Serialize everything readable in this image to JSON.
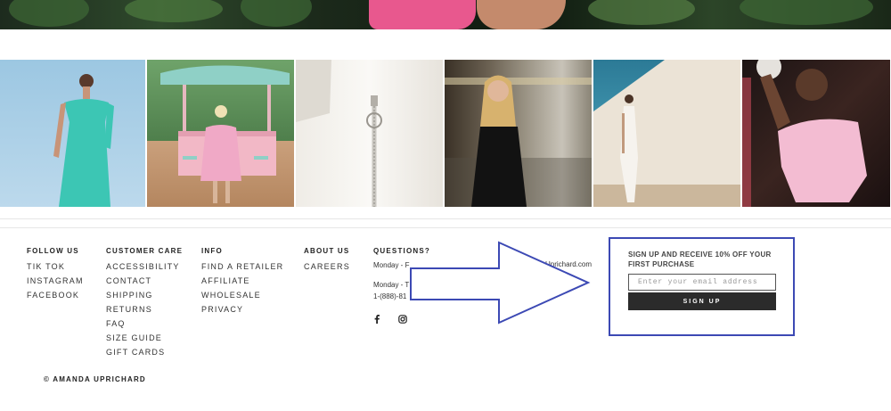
{
  "footer": {
    "follow_us": {
      "heading": "FOLLOW US",
      "items": [
        "TIK TOK",
        "INSTAGRAM",
        "FACEBOOK"
      ]
    },
    "customer_care": {
      "heading": "CUSTOMER CARE",
      "items": [
        "ACCESSIBILITY",
        "CONTACT",
        "SHIPPING",
        "RETURNS",
        "FAQ",
        "SIZE GUIDE",
        "GIFT CARDS"
      ]
    },
    "info": {
      "heading": "INFO",
      "items": [
        "FIND A RETAILER",
        "AFFILIATE",
        "WHOLESALE",
        "PRIVACY"
      ]
    },
    "about_us": {
      "heading": "ABOUT US",
      "items": [
        "CAREERS"
      ]
    },
    "questions": {
      "heading": "QUESTIONS?",
      "line1_start": "Monday - F",
      "line1_end": "Uprichard.com",
      "line2_start": "Monday - T",
      "phone_start": "1-(888)-81"
    },
    "social_icons": [
      "facebook-icon",
      "instagram-icon"
    ],
    "copyright": "© AMANDA UPRICHARD"
  },
  "signup": {
    "title": "SIGN UP AND RECEIVE 10% OFF YOUR FIRST PURCHASE",
    "email_placeholder": "Enter your email address",
    "button_label": "SIGN UP"
  },
  "colors": {
    "highlight_border": "#3c49b4",
    "arrow_stroke": "#3c49b4",
    "button_bg": "#2b2b2b"
  }
}
